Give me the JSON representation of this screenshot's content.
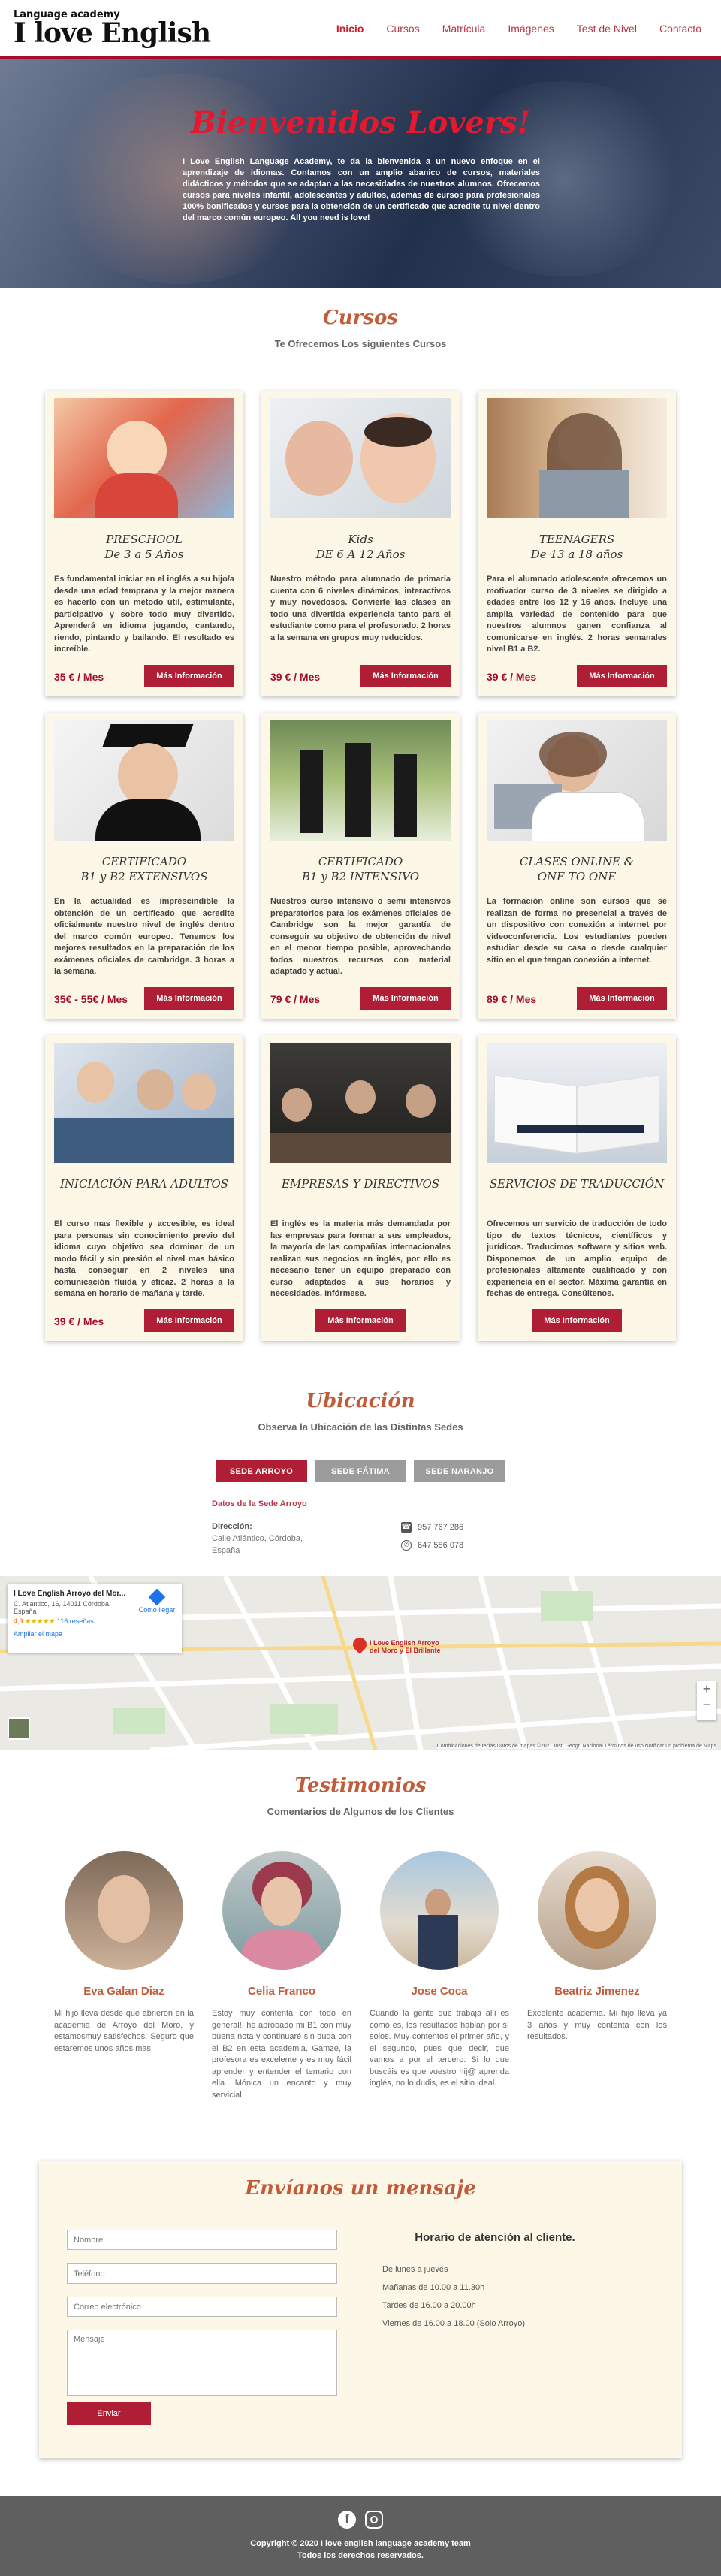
{
  "header": {
    "logo_small": "Language academy",
    "logo_large": "I love English",
    "nav": [
      "Inicio",
      "Cursos",
      "Matrícula",
      "Imágenes",
      "Test de Nivel",
      "Contacto"
    ]
  },
  "hero": {
    "title": "Bienvenidos Lovers!",
    "text": "I Love English Language Academy, te da la bienvenida a un nuevo enfoque en el aprendizaje de idiomas. Contamos con un amplio abanico de cursos, materiales didácticos y métodos que se adaptan a las necesidades de nuestros alumnos. Ofrecemos cursos para niveles infantil, adolescentes y adultos, además de cursos para profesionales 100% bonificados y cursos para la obtención de un certificado que acredite tu nivel dentro del marco común europeo. All you need is love!"
  },
  "courses": {
    "title": "Cursos",
    "subtitle": "Te Ofrecemos Los siguientes Cursos",
    "button_label": "Más Información",
    "items": [
      {
        "title1": "PRESCHOOL",
        "title2": "De 3 a 5 Años",
        "desc": "Es fundamental iniciar en el inglés a su hijo/a desde una edad temprana y la mejor manera es hacerlo con un método útil, estimulante, participativo y sobre todo muy divertido. Aprenderá en idioma jugando, cantando, riendo, pintando y bailando. El resultado es increíble.",
        "price": "35 € / Mes"
      },
      {
        "title1": "Kids",
        "title2": "DE 6 A 12 Años",
        "desc": "Nuestro método para alumnado de primaria cuenta con 6 niveles dinámicos, interactivos y muy novedosos. Convierte las clases en todo una divertida experiencia tanto para el estudiante como para el profesorado. 2 horas a la semana en grupos muy reducidos.",
        "price": "39 € / Mes"
      },
      {
        "title1": "TEENAGERS",
        "title2": "De 13 a 18 años",
        "desc": "Para el alumnado adolescente ofrecemos un motivador curso de 3 niveles se dirigido a edades entre los 12 y 16 años. Incluye una amplia variedad de contenido para que nuestros alumnos ganen confianza al comunicarse en inglés. 2 horas semanales nivel B1 a B2.",
        "price": "39 € / Mes"
      },
      {
        "title1": "CERTIFICADO",
        "title2": "B1 y B2 EXTENSIVOS",
        "desc": "En la actualidad es imprescindible la obtención de un certificado que acredite oficialmente nuestro nivel de inglés dentro del marco común europeo. Tenemos los mejores resultados en la preparación de los exámenes oficiales de cambridge. 3 horas a la semana.",
        "price": "35€ - 55€ / Mes"
      },
      {
        "title1": "CERTIFICADO",
        "title2": "B1 y B2 INTENSIVO",
        "desc": "Nuestros curso intensivo o semi intensivos preparatorios para los exámenes oficiales de Cambridge son la mejor garantía de conseguir su objetivo de obtención de nivel en el menor tiempo posible, aprovechando todos nuestros recursos con material adaptado y actual.",
        "price": "79 € / Mes"
      },
      {
        "title1": "CLASES ONLINE &",
        "title2": "ONE TO ONE",
        "desc": "La formación online son cursos que se realizan de forma no presencial a través de un dispositivo con conexión a internet por videoconferencia. Los estudiantes pueden estudiar desde su casa o desde cualquier sitio en el que tengan conexión a internet.",
        "price": "89 € / Mes"
      },
      {
        "title1": "INICIACIÓN PARA ADULTOS",
        "title2": "",
        "desc": "El curso mas flexible y accesible, es ideal para personas sin conocimiento previo del idioma cuyo objetivo sea dominar de un modo fácil y sin presión el nivel mas básico hasta conseguir en 2 niveles una comunicación fluida y eficaz. 2 horas a la semana en horario de mañana y tarde.",
        "price": "39 € / Mes"
      },
      {
        "title1": "EMPRESAS Y DIRECTIVOS",
        "title2": "",
        "desc": "El inglés es la materia más demandada por las empresas para formar a sus empleados, la mayoría de las compañías internacionales realizan sus negocios en inglés, por ello es necesario tener un equipo preparado con curso adaptados a sus horarios y necesidades. Infórmese.",
        "price": ""
      },
      {
        "title1": "SERVICIOS DE TRADUCCIÓN",
        "title2": "",
        "desc": "Ofrecemos un servicio de traducción de todo tipo de textos técnicos, científicos y jurídicos. Traducimos software y sitios web. Disponemos de un amplio equipo de profesionales altamente cualificado y con experiencia en el sector. Máxima garantía en fechas de entrega. Consúltenos.",
        "price": ""
      }
    ]
  },
  "location": {
    "title": "Ubicación",
    "subtitle": "Observa la Ubicación de las Distintas Sedes",
    "tabs": [
      "SEDE ARROYO",
      "SEDE FÁTIMA",
      "SEDE NARANJO"
    ],
    "data_title": "Datos de la Sede Arroyo",
    "address_label": "Dirección:",
    "address": "Calle Atlántico, Córdoba, España",
    "phone": "957 767 286",
    "whatsapp": "647 586 078",
    "map_card_title": "I Love English Arroyo del Mor...",
    "map_card_address": "C. Atlántico, 16, 14011 Córdoba, España",
    "map_card_rating": "4,9",
    "map_card_reviews": "116 reseñas",
    "map_card_link": "Ampliar el mapa",
    "map_card_dir": "Cómo llegar",
    "map_pin_label": "I Love English Arroyo del Moro y El Brillante",
    "map_footer": "Combinaciones de teclas   Datos de mapas ©2021 Inst. Geogr. Nacional   Términos de uso   Notificar un problema de Maps"
  },
  "testimonials": {
    "title": "Testimonios",
    "subtitle": "Comentarios de Algunos de los Clientes",
    "items": [
      {
        "name": "Eva Galan Diaz",
        "quote": "Mi hijo lleva desde que abrieron en la academia de Arroyo del Moro, y estamosmuy satisfechos. Seguro que estaremos unos años mas."
      },
      {
        "name": "Celia Franco",
        "quote": "Estoy muy contenta con todo en general!, he aprobado mi B1 con muy buena nota y continuaré sin duda con el B2 en esta academia. Gamze, la profesora es excelente y es muy fácil aprender y entender el temario con ella. Mónica un encanto y muy servicial."
      },
      {
        "name": "Jose Coca",
        "quote": "Cuando la gente que trabaja allí es como es, los resultados hablan por sí solos. Muy contentos el primer año, y el segundo, pues que decir, que vamos a por el tercero. Si lo que buscáis es que vuestro hij@ aprenda inglés, no lo dudis, es el sitio ideal."
      },
      {
        "name": "Beatriz Jimenez",
        "quote": "Excelente academia. Mi hijo lleva ya 3 años y muy contenta con los resultados."
      }
    ]
  },
  "contact": {
    "title": "Envíanos un mensaje",
    "name_ph": "Nombre",
    "phone_ph": "Teléfono",
    "email_ph": "Correo electrónico",
    "message_ph": "Mensaje",
    "send": "Enviar",
    "hours_title": "Horario de atención al cliente.",
    "hours": [
      "De lunes a jueves",
      "Mañanas de 10.00 a 11.30h",
      "Tardes de 16.00 a 20.00h",
      "Viernes de 16.00 a 18.00 (Solo Arroyo)"
    ]
  },
  "footer": {
    "line1": "Copyright © 2020 I love english language academy team",
    "line2": "Todos los derechos reservados."
  },
  "colors": {
    "brand": "#b01e35",
    "accent": "#c25b3a",
    "card_bg": "#fdf7e8"
  }
}
